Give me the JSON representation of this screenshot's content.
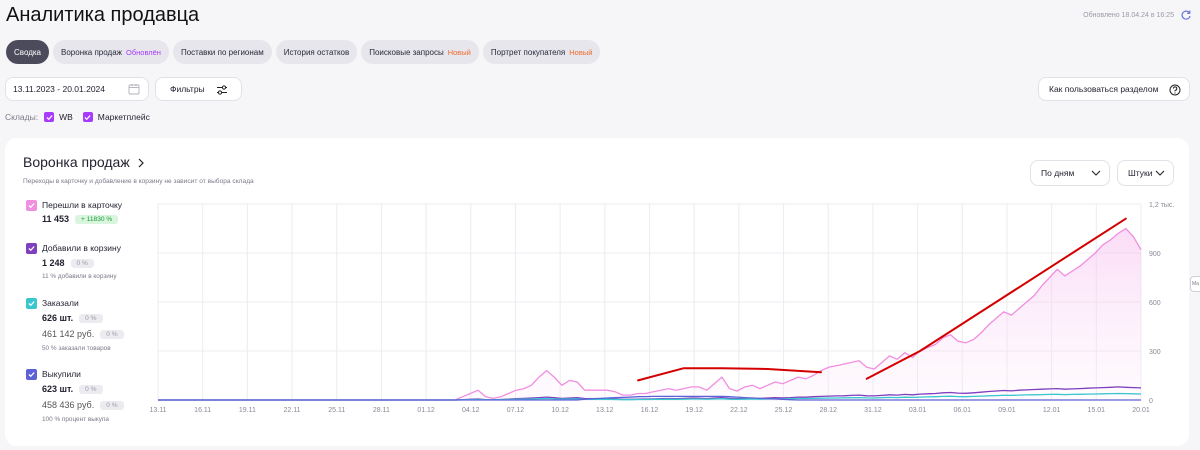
{
  "header": {
    "title": "Аналитика продавца",
    "updated": "Обновлено 18.04.24 в 16:25"
  },
  "tabs": [
    {
      "label": "Сводка",
      "badge": ""
    },
    {
      "label": "Воронка продаж",
      "badge": "Обновлён"
    },
    {
      "label": "Поставки по регионам",
      "badge": ""
    },
    {
      "label": "История остатков",
      "badge": ""
    },
    {
      "label": "Поисковые запросы",
      "badge": "Новый"
    },
    {
      "label": "Портрет покупателя",
      "badge": "Новый"
    }
  ],
  "toolbar": {
    "date_range": "13.11.2023 - 20.01.2024",
    "filters_label": "Фильтры",
    "help_label": "Как пользоваться разделом"
  },
  "warehouses": {
    "label": "Склады:",
    "items": [
      "WB",
      "Маркетплейс"
    ]
  },
  "card": {
    "title": "Воронка продаж",
    "subtitle": "Переходы в карточку и добавление в корзину не зависит от выбора склада",
    "period_select": "По дням",
    "units_select": "Штуки"
  },
  "metrics": {
    "cards": {
      "label": "Перешли в карточку",
      "value": "11 453",
      "change": "+ 11830 %"
    },
    "cart": {
      "label": "Добавили в корзину",
      "value": "1 248",
      "change": "0 %",
      "note": "11 % добавили в корзину"
    },
    "orders": {
      "label": "Заказали",
      "value": "626 шт.",
      "change": "0 %",
      "value2": "461 142 руб.",
      "change2": "0 %",
      "note": "50 % заказали товаров"
    },
    "buyouts": {
      "label": "Выкупили",
      "value": "623 шт.",
      "change": "0 %",
      "value2": "458 436 руб.",
      "change2": "0 %",
      "note": "100 % процент выкупа"
    }
  },
  "colors": {
    "cards": "#f08ee0",
    "cart": "#7f3fbf",
    "orders": "#39c6cf",
    "buyouts": "#5c62d6",
    "annotation": "#d40000",
    "accent": "#a73afd"
  },
  "chart_data": {
    "type": "line",
    "x_ticks": [
      "13.11",
      "16.11",
      "19.11",
      "22.11",
      "25.11",
      "28.11",
      "01.12",
      "04.12",
      "07.12",
      "10.12",
      "13.12",
      "16.12",
      "19.12",
      "22.12",
      "25.12",
      "28.12",
      "31.12",
      "03.01",
      "06.01",
      "09.01",
      "12.01",
      "15.01",
      "20.01"
    ],
    "y_ticks": [
      "0",
      "300",
      "600",
      "900",
      "1,2 тыс."
    ],
    "ylim": [
      0,
      1200
    ],
    "x_start": "2023-11-13",
    "x_end": "2024-01-20",
    "series": [
      {
        "name": "Перешли в карточку",
        "color_key": "cards",
        "fill": true,
        "values": [
          0,
          0,
          0,
          0,
          0,
          0,
          0,
          0,
          0,
          0,
          0,
          0,
          0,
          0,
          0,
          0,
          0,
          0,
          0,
          0,
          0,
          0,
          0,
          0,
          0,
          0,
          0,
          0,
          0,
          0,
          0,
          0,
          0,
          0,
          0,
          0,
          0,
          0,
          0,
          0,
          20,
          40,
          60,
          20,
          10,
          20,
          40,
          60,
          70,
          90,
          140,
          180,
          140,
          90,
          120,
          110,
          60,
          60,
          60,
          60,
          50,
          30,
          30,
          40,
          40,
          50,
          60,
          70,
          60,
          70,
          80,
          80,
          60,
          100,
          140,
          70,
          55,
          80,
          90,
          70,
          90,
          110,
          100,
          120,
          140,
          130,
          150,
          180,
          200,
          210,
          220,
          230,
          240,
          200,
          190,
          230,
          270,
          250,
          290,
          260,
          300,
          320,
          340,
          380,
          400,
          360,
          350,
          370,
          410,
          460,
          500,
          540,
          520,
          560,
          600,
          640,
          700,
          750,
          800,
          760,
          790,
          820,
          860,
          900,
          950,
          980,
          1020,
          1050,
          1000,
          920
        ]
      },
      {
        "name": "Добавили в корзину",
        "color_key": "cart",
        "fill": false,
        "values": [
          0,
          0,
          0,
          0,
          0,
          0,
          0,
          0,
          0,
          0,
          0,
          0,
          0,
          0,
          0,
          0,
          0,
          0,
          0,
          0,
          0,
          0,
          0,
          0,
          0,
          0,
          0,
          0,
          0,
          0,
          0,
          0,
          0,
          0,
          0,
          0,
          0,
          0,
          0,
          0,
          2,
          4,
          6,
          2,
          1,
          3,
          5,
          8,
          10,
          12,
          15,
          18,
          14,
          10,
          12,
          14,
          9,
          8,
          8,
          8,
          6,
          4,
          4,
          5,
          6,
          7,
          8,
          9,
          8,
          10,
          12,
          11,
          9,
          12,
          15,
          10,
          8,
          10,
          12,
          10,
          12,
          14,
          13,
          15,
          18,
          17,
          20,
          22,
          24,
          25,
          26,
          28,
          30,
          26,
          25,
          28,
          32,
          30,
          34,
          32,
          36,
          38,
          40,
          44,
          46,
          42,
          41,
          44,
          48,
          52,
          55,
          58,
          56,
          60,
          62,
          64,
          66,
          68,
          70,
          66,
          68,
          70,
          72,
          74,
          76,
          78,
          80,
          78,
          76,
          74
        ]
      },
      {
        "name": "Заказали",
        "color_key": "orders",
        "fill": false,
        "values": [
          0,
          0,
          0,
          0,
          0,
          0,
          0,
          0,
          0,
          0,
          0,
          0,
          0,
          0,
          0,
          0,
          0,
          0,
          0,
          0,
          0,
          0,
          0,
          0,
          0,
          0,
          0,
          0,
          0,
          0,
          0,
          0,
          0,
          0,
          0,
          0,
          0,
          0,
          0,
          0,
          1,
          2,
          3,
          1,
          1,
          2,
          3,
          4,
          5,
          6,
          8,
          9,
          7,
          5,
          6,
          7,
          5,
          4,
          4,
          4,
          3,
          2,
          2,
          3,
          3,
          4,
          4,
          5,
          4,
          5,
          6,
          6,
          5,
          6,
          8,
          5,
          4,
          5,
          6,
          5,
          6,
          7,
          7,
          8,
          9,
          9,
          10,
          11,
          12,
          12,
          13,
          14,
          15,
          13,
          12,
          14,
          16,
          15,
          17,
          16,
          18,
          19,
          20,
          22,
          23,
          21,
          20,
          22,
          24,
          26,
          27,
          29,
          28,
          30,
          31,
          32,
          33,
          34,
          35,
          33,
          34,
          35,
          36,
          37,
          38,
          39,
          40,
          39,
          38,
          37
        ]
      },
      {
        "name": "Выкупили",
        "color_key": "buyouts",
        "fill": false,
        "values": [
          0,
          0,
          0,
          0,
          0,
          0,
          0,
          0,
          0,
          0,
          0,
          0,
          0,
          0,
          0,
          0,
          0,
          0,
          0,
          0,
          0,
          0,
          0,
          0,
          0,
          0,
          0,
          0,
          0,
          0,
          0,
          0,
          0,
          0,
          0,
          0,
          0,
          0,
          0,
          0,
          0,
          0,
          0,
          0,
          0,
          0,
          0,
          0,
          0,
          0,
          0,
          0,
          0,
          0,
          0,
          0,
          5,
          8,
          10,
          12,
          14,
          16,
          18,
          20,
          21,
          22,
          22,
          22,
          22,
          22,
          22,
          22,
          22,
          22,
          22,
          20,
          18,
          15,
          12,
          10,
          8,
          6,
          4,
          2,
          0,
          0,
          0,
          0,
          0,
          0,
          0,
          0,
          0,
          0,
          0,
          0,
          0,
          0,
          0,
          0,
          0,
          0,
          0,
          0,
          0,
          0,
          0,
          0,
          0,
          0,
          0,
          0,
          0,
          0,
          0,
          0,
          0,
          0,
          0,
          0,
          0,
          0,
          0,
          0,
          0,
          0,
          0,
          0,
          0,
          0
        ]
      }
    ],
    "annotations": [
      {
        "type": "hand-drawn-line",
        "color_key": "annotation",
        "points": [
          [
            63,
            120
          ],
          [
            69,
            195
          ],
          [
            74,
            195
          ],
          [
            80,
            190
          ],
          [
            87,
            170
          ]
        ]
      },
      {
        "type": "hand-drawn-line",
        "color_key": "annotation",
        "points": [
          [
            93,
            130
          ],
          [
            100,
            300
          ],
          [
            110,
            600
          ],
          [
            120,
            900
          ],
          [
            127,
            1110
          ]
        ]
      }
    ]
  }
}
